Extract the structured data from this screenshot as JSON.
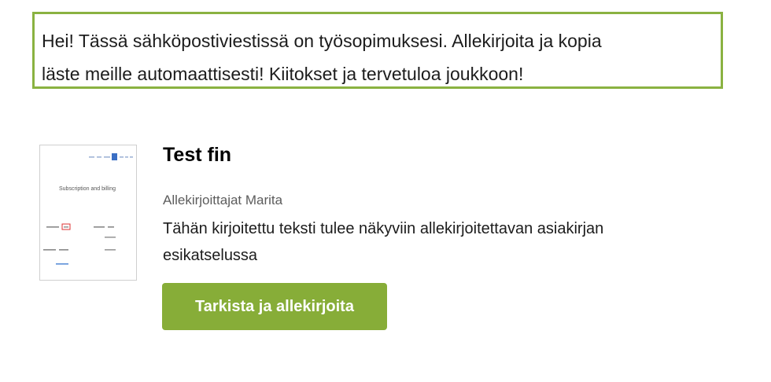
{
  "message": {
    "line1": "Hei! Tässä sähköpostiviestissä on työsopimuksesi. Allekirjoita ja kopia",
    "line2": "läste meille automaattisesti! Kiitokset ja tervetuloa joukkoon!"
  },
  "document": {
    "title": "Test fin",
    "signers": "Allekirjoittajat Marita",
    "description": "Tähän kirjoitettu teksti tulee näkyviin allekirjoitettavan asiakirjan esikatselussa",
    "thumbnail": {
      "heading": "Subscription and billing"
    }
  },
  "actions": {
    "review_sign_label": "Tarkista ja allekirjoita"
  },
  "colors": {
    "accent": "#87ad38",
    "frame": "#8ab241"
  }
}
